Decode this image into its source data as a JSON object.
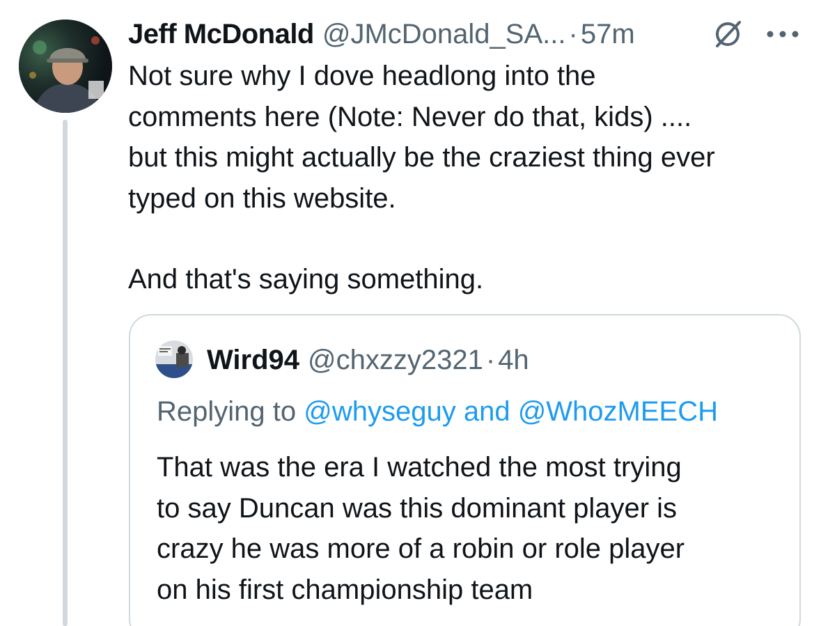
{
  "tweet": {
    "author_name": "Jeff McDonald",
    "author_handle": "@JMcDonald_SA...",
    "separator": "·",
    "time": "57m",
    "icons": {
      "grok": "grok-slash-icon",
      "more": "more-horizontal-icon"
    },
    "text_line1": "Not sure why I dove headlong into the\ncomments here (Note: Never do that, kids) ....\nbut this might actually be the craziest thing ever\ntyped on this website.",
    "text_line2": "And that's saying something."
  },
  "quote": {
    "author_name": "Wird94",
    "author_handle": "@chxzzy2321",
    "separator": "·",
    "time": "4h",
    "replying_prefix": "Replying to ",
    "reply_to_1": "@whyseguy",
    "reply_conjunction": " and ",
    "reply_to_2": "@WhozMEECH",
    "text": "That was the era I watched the most trying\nto say Duncan was this dominant player is\ncrazy he was more of a robin or role player\non his first championship team"
  },
  "colors": {
    "text_primary": "#0f1419",
    "text_secondary": "#536471",
    "link": "#1d9bf0",
    "border": "#cfd9de"
  }
}
